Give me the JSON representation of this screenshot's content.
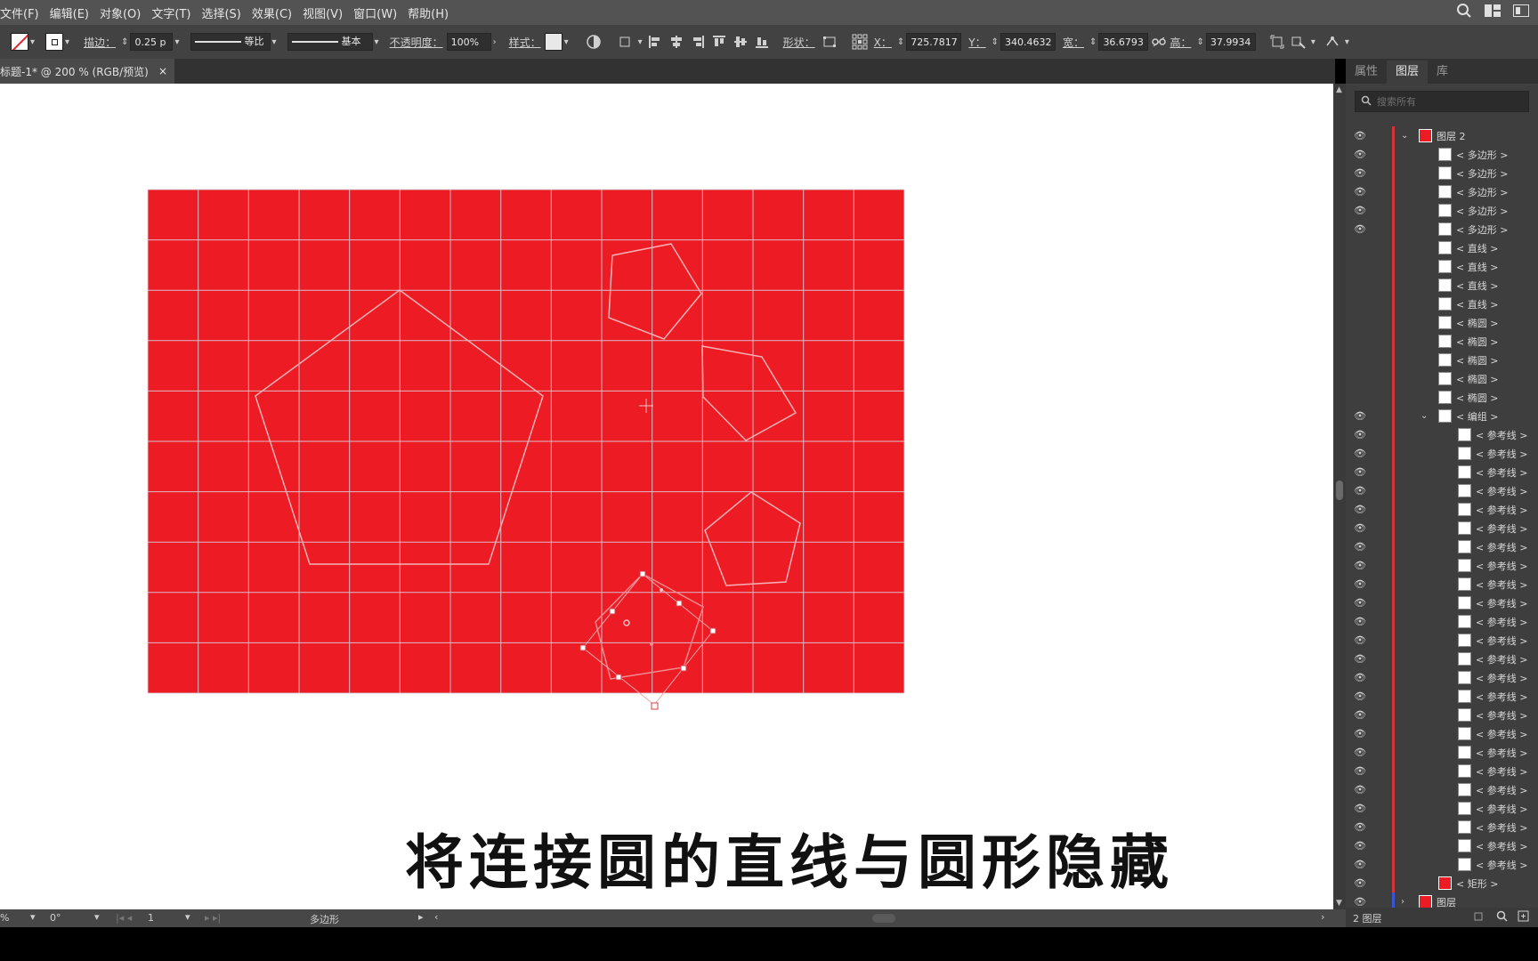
{
  "menu": [
    "文件(F)",
    "编辑(E)",
    "对象(O)",
    "文字(T)",
    "选择(S)",
    "效果(C)",
    "视图(V)",
    "窗口(W)",
    "帮助(H)"
  ],
  "toolbar": {
    "stroke_label": "描边：",
    "stroke_value": "0.25 p",
    "profile_value": "等比",
    "brush_value": "基本",
    "opacity_label": "不透明度：",
    "opacity_value": "100%",
    "style_label": "样式：",
    "shape_label": "形状：",
    "x_label": "X：",
    "x_value": "725.7817",
    "y_label": "Y：",
    "y_value": "340.4632",
    "w_label": "宽：",
    "w_value": "36.6793",
    "h_label": "高：",
    "h_value": "37.9934"
  },
  "document_tab": {
    "title": "标题-1* @ 200 % (RGB/预览)",
    "close": "×"
  },
  "panel": {
    "tabs": [
      "属性",
      "图层",
      "库"
    ],
    "active_tab": "图层",
    "search_placeholder": "搜索所有",
    "layer_top": "图层 2",
    "polygon": "< 多边形 >",
    "line": "< 直线 >",
    "ellipse": "< 椭圆 >",
    "group": "< 编组 >",
    "guide": "< 参考线 >",
    "rect": "< 矩形 >",
    "layer_bottom": "图层",
    "footer": "2 图层"
  },
  "status": {
    "zoom": "%",
    "rotate": "0°",
    "artboard": "1",
    "tool": "多边形"
  },
  "caption": "将连接圆的直线与圆形隐藏",
  "colors": {
    "red": "#ed1c24",
    "ui_dark": "#424242",
    "layer_red": "#d2343a"
  }
}
